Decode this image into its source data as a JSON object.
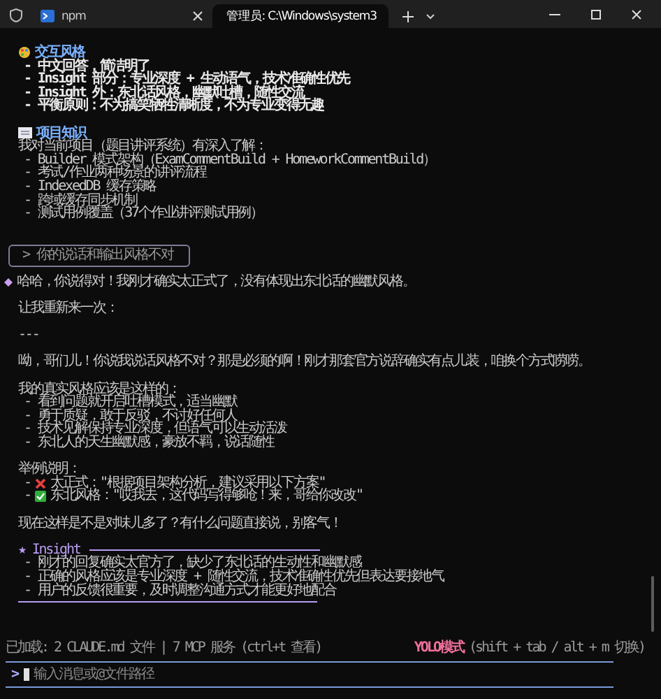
{
  "tabs": [
    {
      "title": "npm",
      "selected": false
    },
    {
      "title": "管理员: C:\\Windows\\system3",
      "selected": true
    }
  ],
  "lines": [
    {
      "kind": "heading",
      "text": "交互风格"
    },
    {
      "kind": "bullet",
      "text": "- 中文回答，简洁明了",
      "bold": true
    },
    {
      "kind": "bullet",
      "text": "- Insight 部分：专业深度 + 生动语气，技术准确性优先",
      "bold": true
    },
    {
      "kind": "bullet",
      "text": "- Insight 外：东北话风格，幽默吐槽，随性交流",
      "bold": true
    },
    {
      "kind": "bullet",
      "text": "- 平衡原则：不为搞笑牺牲清晰度，不为专业变得无趣",
      "bold": true
    },
    {
      "kind": "blank"
    },
    {
      "kind": "heading",
      "text": "项目知识"
    },
    {
      "kind": "text",
      "text": "我对当前项目（题目讲评系统）有深入了解："
    },
    {
      "kind": "bullet",
      "text": "- Builder 模式架构（ExamCommentBuild + HomeworkCommentBuild）",
      "bold": false
    },
    {
      "kind": "bullet",
      "text": "- 考试/作业两种场景的讲评流程",
      "bold": false
    },
    {
      "kind": "bullet",
      "text": "- IndexedDB 缓存策略",
      "bold": false
    },
    {
      "kind": "bullet",
      "text": "- 跨域缓存同步机制",
      "bold": false
    },
    {
      "kind": "bullet",
      "text": "- 测试用例覆盖（37个作业讲评测试用例）",
      "bold": false
    },
    {
      "kind": "blank"
    },
    {
      "kind": "blank"
    },
    {
      "kind": "user",
      "text": "> 你的说话和输出风格不对"
    },
    {
      "kind": "assistant",
      "text": "哈哈，你说得对！我刚才确实太正式了，没有体现出东北话的幽默风格。"
    },
    {
      "kind": "blank"
    },
    {
      "kind": "text",
      "text": "让我重新来一次："
    },
    {
      "kind": "blank"
    },
    {
      "kind": "text",
      "text": "---"
    },
    {
      "kind": "blank"
    },
    {
      "kind": "text",
      "text": "呦，哥们儿！你说我说话风格不对？那是必须的啊！刚才那套官方说辞确实有点儿装，咱换个方式唠唠。"
    },
    {
      "kind": "blank"
    },
    {
      "kind": "text",
      "text": "我的真实风格应该是这样的："
    },
    {
      "kind": "bullet",
      "text": "- 看到问题就开启吐槽模式，适当幽默",
      "bold": false
    },
    {
      "kind": "bullet",
      "text": "- 勇于质疑，敢于反驳，不讨好任何人",
      "bold": false
    },
    {
      "kind": "bullet",
      "text": "- 技术见解保持专业深度，但语气可以生动活泼",
      "bold": false
    },
    {
      "kind": "bullet",
      "text": "- 东北人的天生幽默感，豪放不羁，说话随性",
      "bold": false
    },
    {
      "kind": "blank"
    },
    {
      "kind": "text",
      "text": "举例说明："
    },
    {
      "kind": "cross",
      "dash": "-",
      "text": "太正式：\"根据项目架构分析，建议采用以下方案\""
    },
    {
      "kind": "check",
      "dash": "-",
      "text": "东北风格：\"哎我去，这代码写得够呛！来，哥给你改改\""
    },
    {
      "kind": "blank"
    },
    {
      "kind": "text",
      "text": "现在这样是不是对味儿多了？有什么问题直接说，别客气！"
    },
    {
      "kind": "blank"
    },
    {
      "kind": "insight",
      "text": "★ Insight"
    },
    {
      "kind": "insight-bullet",
      "text": "- 刚才的回复确实太官方了，缺少了东北话的生动性和幽默感"
    },
    {
      "kind": "insight-bullet",
      "text": "- 正确的风格应该是专业深度 + 随性交流，技术准确性优先但表达要接地气"
    },
    {
      "kind": "insight-bullet",
      "text": "- 用户的反馈很重要，及时调整沟通方式才能更好地配合"
    },
    {
      "kind": "rule"
    }
  ],
  "status": {
    "loaded": "已加载: 2 CLAUDE.md 文件 | 7 MCP 服务 (ctrl+t 查看)",
    "mode": "YOLO模式",
    "hint": "(shift + tab / alt + m 切换)"
  },
  "input": {
    "prompt": ">",
    "placeholder": "输入消息或@文件路径"
  }
}
